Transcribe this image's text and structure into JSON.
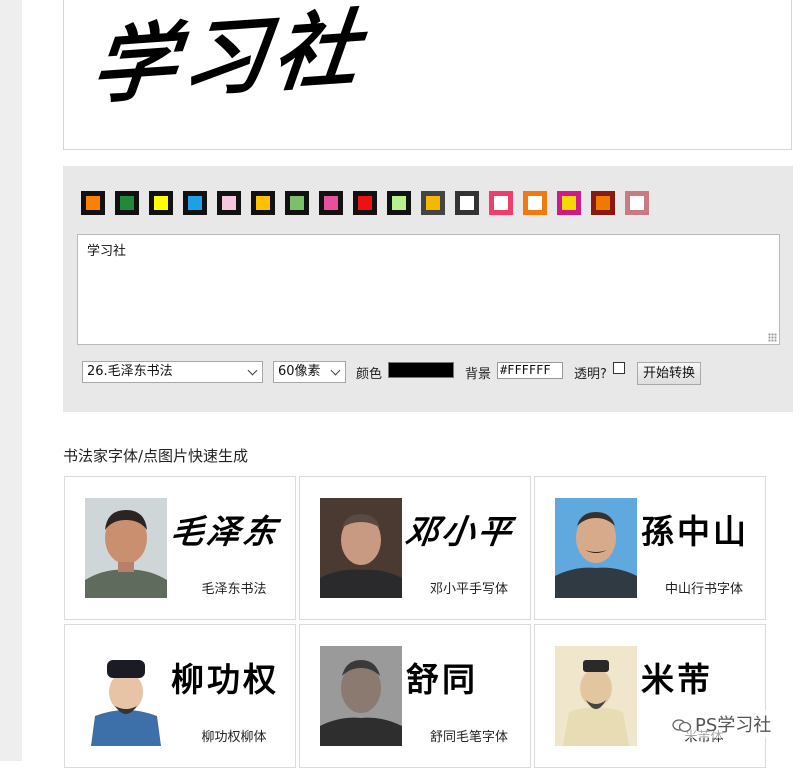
{
  "preview": {
    "text": "学习社"
  },
  "swatches": [
    {
      "inner": "#ff7f00",
      "border": "#111111"
    },
    {
      "inner": "#1f8a3a",
      "border": "#111111"
    },
    {
      "inner": "#ffff00",
      "border": "#111111"
    },
    {
      "inner": "#1ea0e6",
      "border": "#111111"
    },
    {
      "inner": "#f6c6de",
      "border": "#111111"
    },
    {
      "inner": "#ffc000",
      "border": "#111111"
    },
    {
      "inner": "#7cc06a",
      "border": "#111111"
    },
    {
      "inner": "#e84f9c",
      "border": "#111111"
    },
    {
      "inner": "#ee1111",
      "border": "#111111"
    },
    {
      "inner": "#b8f08c",
      "border": "#111111"
    },
    {
      "inner": "#f5b800",
      "border": "#444444"
    },
    {
      "inner": "#ffffff",
      "border": "#333333"
    },
    {
      "inner": "#ffffff",
      "border": "#f03e6a"
    },
    {
      "inner": "#ffffff",
      "border": "#f07a10"
    },
    {
      "inner": "#f5d800",
      "border": "#d01a8a"
    },
    {
      "inner": "#f07a00",
      "border": "#8a1a10"
    },
    {
      "inner": "#ffffff",
      "border": "#c97a85"
    }
  ],
  "textarea": {
    "value": "学习社"
  },
  "controls": {
    "font_select": "26.毛泽东书法",
    "size_select": "60像素",
    "color_label": "颜色",
    "color_value": "#000000",
    "bg_label": "背景",
    "bg_value": "#FFFFFF",
    "transparent_label": "透明?",
    "start_button": "开始转换"
  },
  "section": {
    "title": "书法家字体/点图片快速生成"
  },
  "cards": [
    {
      "sample": "毛泽东",
      "caption": "毛泽东书法"
    },
    {
      "sample": "邓小平",
      "caption": "邓小平手写体"
    },
    {
      "sample": "孫中山",
      "caption": "中山行书字体"
    },
    {
      "sample": "柳功权",
      "caption": "柳功权柳体"
    },
    {
      "sample": "舒同",
      "caption": "舒同毛笔字体"
    },
    {
      "sample": "米芾",
      "caption": "米芾体"
    }
  ],
  "watermark": {
    "text": "PS学习社"
  }
}
